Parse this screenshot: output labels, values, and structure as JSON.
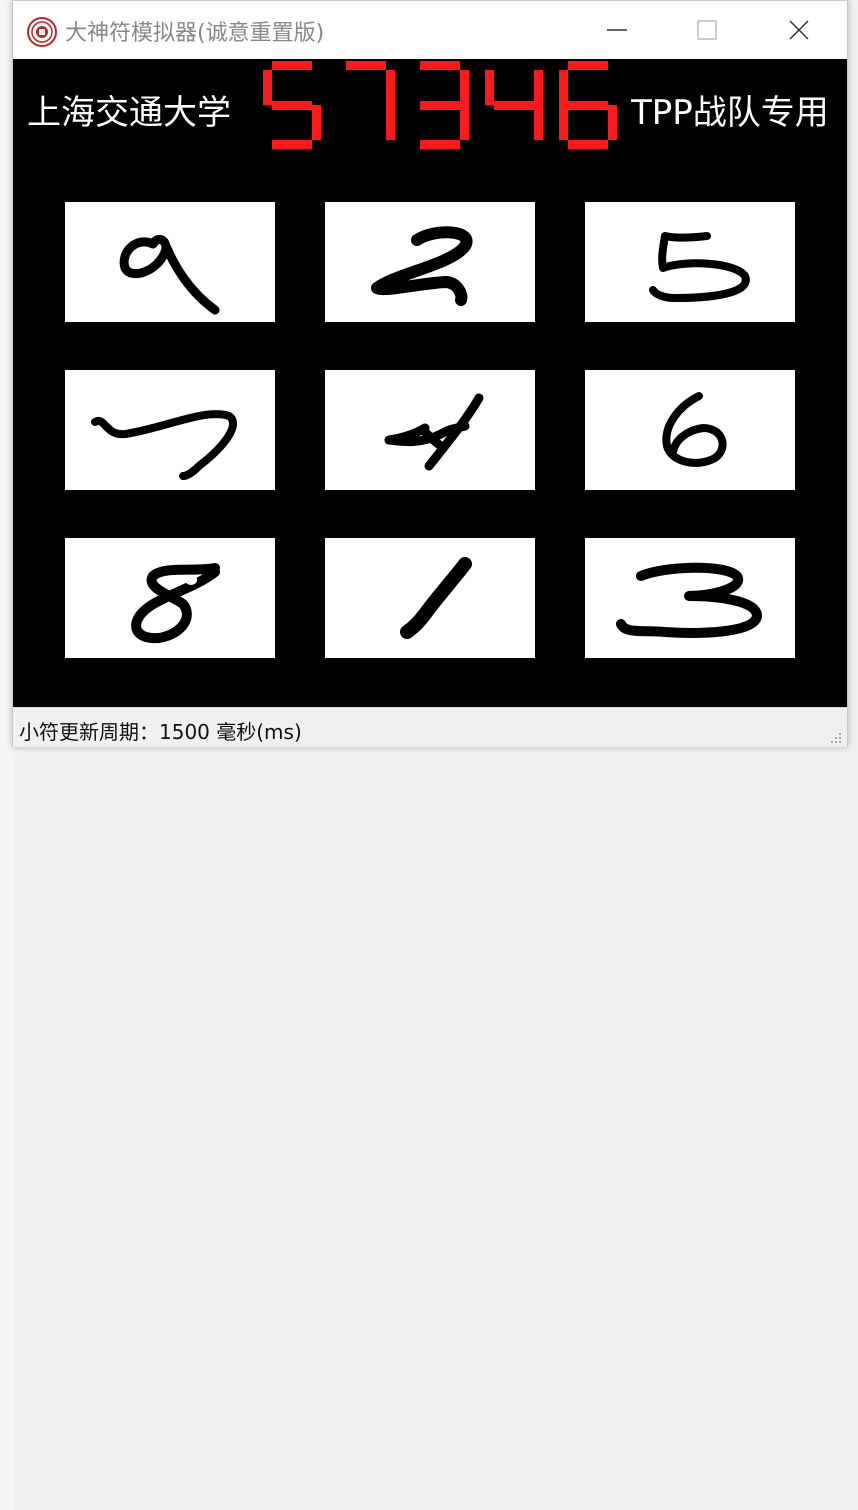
{
  "window": {
    "title": "大神符模拟器(诚意重置版)",
    "icon": "app-seal-icon"
  },
  "controls": {
    "minimize_icon": "minimize-icon",
    "maximize_icon": "maximize-icon",
    "close_icon": "close-icon"
  },
  "banner": {
    "left_text": "上海交通大学",
    "right_text": "TPP战队专用",
    "password_digits": [
      "5",
      "7",
      "3",
      "4",
      "6"
    ],
    "digit_color": "#ff1a1a"
  },
  "grid": {
    "digits": [
      "9",
      "2",
      "5",
      "7",
      "4",
      "6",
      "8",
      "1",
      "3"
    ]
  },
  "status": {
    "text": "小符更新周期：1500 毫秒(ms)"
  }
}
